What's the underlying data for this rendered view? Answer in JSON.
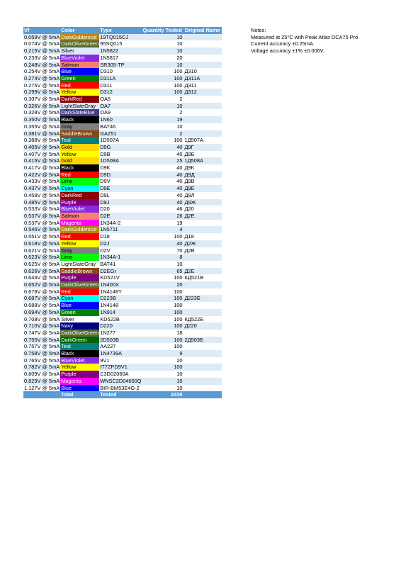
{
  "headers": [
    "Vf",
    "Color",
    "Type",
    "Quantity Tested",
    "Original Name"
  ],
  "rows": [
    {
      "vf": "0.059V @ 5mA",
      "color": "DarkGoldenrod",
      "swatch": "#b8860b",
      "text": "#ffffff",
      "type": "19TQ015CJ",
      "qty": "10",
      "orig": ""
    },
    {
      "vf": "0.074V @ 5mA",
      "color": "DarkOliveGreen",
      "swatch": "#556b2f",
      "text": "#ffffff",
      "type": "95SQ015",
      "qty": "10",
      "orig": ""
    },
    {
      "vf": "0.215V @ 5mA",
      "color": "Silver",
      "swatch": "",
      "text": "",
      "type": "1N5822",
      "qty": "10",
      "orig": ""
    },
    {
      "vf": "0.233V @ 5mA",
      "color": "BlueViolet",
      "swatch": "#8a2be2",
      "text": "#ffffff",
      "type": "1N5817",
      "qty": "20",
      "orig": ""
    },
    {
      "vf": "0.248V @ 5mA",
      "color": "Salmon",
      "swatch": "#fa8072",
      "text": "#000000",
      "type": "SR305-TP",
      "qty": "10",
      "orig": ""
    },
    {
      "vf": "0.254V @ 5mA",
      "color": "Blue",
      "swatch": "#0000ff",
      "text": "#ffffff",
      "type": "D310",
      "qty": "100",
      "orig": "Д310"
    },
    {
      "vf": "0.274V @ 5mA",
      "color": "Green",
      "swatch": "#008000",
      "text": "#ffffff",
      "type": "D311A",
      "qty": "100",
      "orig": "Д311А"
    },
    {
      "vf": "0.275V @ 5mA",
      "color": "Red",
      "swatch": "#ff0000",
      "text": "#ffffff",
      "type": "D311",
      "qty": "100",
      "orig": "Д311"
    },
    {
      "vf": "0.299V @ 5mA",
      "color": "Yellow",
      "swatch": "#ffff00",
      "text": "#000000",
      "type": "D312",
      "qty": "100",
      "orig": "Д312"
    },
    {
      "vf": "0.307V @ 5mA",
      "color": "DarkRed",
      "swatch": "#8b0000",
      "text": "#ffffff",
      "type": "OA5",
      "qty": "2",
      "orig": ""
    },
    {
      "vf": "0.326V @ 5mA",
      "color": "LightSlateGray",
      "swatch": "",
      "text": "",
      "type": "OA7",
      "qty": "10",
      "orig": ""
    },
    {
      "vf": "0.328V @ 5mA",
      "color": "DarkSlateBlue",
      "swatch": "#483d8b",
      "text": "#ffffff",
      "type": "OA9",
      "qty": "2",
      "orig": ""
    },
    {
      "vf": "0.350V @ 5mA",
      "color": "Black",
      "swatch": "#000000",
      "text": "#ffffff",
      "type": "1N60",
      "qty": "19",
      "orig": ""
    },
    {
      "vf": "0.355V @ 5mA",
      "color": "Gray",
      "swatch": "#808080",
      "text": "#000000",
      "type": "BAT46",
      "qty": "10",
      "orig": ""
    },
    {
      "vf": "0.381V @ 5mA",
      "color": "SaddleBrown",
      "swatch": "#8b4513",
      "text": "#ffffff",
      "type": "GAZ51",
      "qty": "2",
      "orig": ""
    },
    {
      "vf": "0.388V @ 5mA",
      "color": "Teal",
      "swatch": "#008080",
      "text": "#ffffff",
      "type": "1D507A",
      "qty": "100",
      "orig": "1Д507А"
    },
    {
      "vf": "0.405V @ 5mA",
      "color": "Gold",
      "swatch": "#ffd700",
      "text": "#000000",
      "type": "D9G",
      "qty": "40",
      "orig": "Д9Г"
    },
    {
      "vf": "0.407V @ 5mA",
      "color": "Yellow",
      "swatch": "#ffff00",
      "text": "#000000",
      "type": "D9B",
      "qty": "40",
      "orig": "Д9Б"
    },
    {
      "vf": "0.415V @ 5mA",
      "color": "Gold",
      "swatch": "#ffd700",
      "text": "#000000",
      "type": "1D508A",
      "qty": "25",
      "orig": "1Д508А"
    },
    {
      "vf": "0.417V @ 5mA",
      "color": "Black",
      "swatch": "#000000",
      "text": "#ffffff",
      "type": "D9K",
      "qty": "40",
      "orig": "Д9К"
    },
    {
      "vf": "0.422V @ 5mA",
      "color": "Red",
      "swatch": "#ff0000",
      "text": "#ffffff",
      "type": "D9D",
      "qty": "40",
      "orig": "Д9Д"
    },
    {
      "vf": "0.433V @ 5mA",
      "color": "Lime",
      "swatch": "#00ff00",
      "text": "#000000",
      "type": "D9V",
      "qty": "40",
      "orig": "Д9В"
    },
    {
      "vf": "0.437V @ 5mA",
      "color": "Cyan",
      "swatch": "#00ffff",
      "text": "#000000",
      "type": "D9E",
      "qty": "40",
      "orig": "Д9Е"
    },
    {
      "vf": "0.459V @ 5mA",
      "color": "DarkRed",
      "swatch": "#8b0000",
      "text": "#ffffff",
      "type": "D9L",
      "qty": "40",
      "orig": "Д9Л"
    },
    {
      "vf": "0.485V @ 5mA",
      "color": "Purple",
      "swatch": "#800080",
      "text": "#ffffff",
      "type": "D9J",
      "qty": "40",
      "orig": "Д9Ж"
    },
    {
      "vf": "0.533V @ 5mA",
      "color": "BlueViolet",
      "swatch": "#8a2be2",
      "text": "#ffffff",
      "type": "D20",
      "qty": "46",
      "orig": "Д20"
    },
    {
      "vf": "0.537V @ 5mA",
      "color": "Salmon",
      "swatch": "#fa8072",
      "text": "#000000",
      "type": "D2E",
      "qty": "26",
      "orig": "Д2Е"
    },
    {
      "vf": "0.537V @ 5mA",
      "color": "Magenta",
      "swatch": "#ff00ff",
      "text": "#ffffff",
      "type": "1N34A-2",
      "qty": "19",
      "orig": ""
    },
    {
      "vf": "0.546V @ 5mA",
      "color": "DarkGoldenrod",
      "swatch": "#b8860b",
      "text": "#ffffff",
      "type": "1N5711",
      "qty": "4",
      "orig": ""
    },
    {
      "vf": "0.551V @ 5mA",
      "color": "Red",
      "swatch": "#ff0000",
      "text": "#ffffff",
      "type": "D18",
      "qty": "100",
      "orig": "Д18"
    },
    {
      "vf": "0.618V @ 5mA",
      "color": "Yellow",
      "swatch": "#ffff00",
      "text": "#000000",
      "type": "D2J",
      "qty": "40",
      "orig": "Д2Ж"
    },
    {
      "vf": "0.621V @ 5mA",
      "color": "Gray",
      "swatch": "#808080",
      "text": "#000000",
      "type": "D2V",
      "qty": "70",
      "orig": "Д2В"
    },
    {
      "vf": "0.623V @ 5mA",
      "color": "Lime",
      "swatch": "#00ff00",
      "text": "#000000",
      "type": "1N34A-1",
      "qty": "8",
      "orig": ""
    },
    {
      "vf": "0.625V @ 5mA",
      "color": "LightSlateGray",
      "swatch": "",
      "text": "",
      "type": "BAT41",
      "qty": "10",
      "orig": ""
    },
    {
      "vf": "0.626V @ 5mA",
      "color": "SaddleBrown",
      "swatch": "#8b4513",
      "text": "#ffffff",
      "type": "D2EGr",
      "qty": "65",
      "orig": "Д2Е"
    },
    {
      "vf": "0.644V @ 5mA",
      "color": "Purple",
      "swatch": "#800080",
      "text": "#ffffff",
      "type": "KD521V",
      "qty": "100",
      "orig": "КД521В"
    },
    {
      "vf": "0.652V @ 5mA",
      "color": "DarkOliveGreen",
      "swatch": "#556b2f",
      "text": "#ffffff",
      "type": "1N400X",
      "qty": "20",
      "orig": ""
    },
    {
      "vf": "0.678V @ 5mA",
      "color": "Red",
      "swatch": "#ff0000",
      "text": "#ffffff",
      "type": "1N4148Y",
      "qty": "100",
      "orig": ""
    },
    {
      "vf": "0.687V @ 5mA",
      "color": "Cyan",
      "swatch": "#00ffff",
      "text": "#000000",
      "type": "D223B",
      "qty": "100",
      "orig": "Д223Б"
    },
    {
      "vf": "0.688V @ 5mA",
      "color": "Blue",
      "swatch": "#0000ff",
      "text": "#ffffff",
      "type": "1N4148",
      "qty": "100",
      "orig": ""
    },
    {
      "vf": "0.694V @ 5mA",
      "color": "Green",
      "swatch": "#008000",
      "text": "#ffffff",
      "type": "1N914",
      "qty": "100",
      "orig": ""
    },
    {
      "vf": "0.708V @ 5mA",
      "color": "Silver",
      "swatch": "",
      "text": "",
      "type": "KD522B",
      "qty": "100",
      "orig": "КД522Б"
    },
    {
      "vf": "0.710V @ 5mA",
      "color": "Navy",
      "swatch": "#000080",
      "text": "#ffffff",
      "type": "D220",
      "qty": "100",
      "orig": "Д220"
    },
    {
      "vf": "0.747V @ 5mA",
      "color": "DarkOliveGreen",
      "swatch": "#556b2f",
      "text": "#ffffff",
      "type": "1N277",
      "qty": "18",
      "orig": ""
    },
    {
      "vf": "0.755V @ 5mA",
      "color": "DarkGreen",
      "swatch": "#006400",
      "text": "#ffffff",
      "type": "2D503B",
      "qty": "100",
      "orig": "2Д503Б"
    },
    {
      "vf": "0.757V @ 5mA",
      "color": "Teal",
      "swatch": "#008080",
      "text": "#ffffff",
      "type": "AA227",
      "qty": "100",
      "orig": ""
    },
    {
      "vf": "0.758V @ 5mA",
      "color": "Black",
      "swatch": "#000000",
      "text": "#ffffff",
      "type": "1N4739A",
      "qty": "9",
      "orig": ""
    },
    {
      "vf": "0.765V @ 5mA",
      "color": "BlueViolet",
      "swatch": "#8a2be2",
      "text": "#ffffff",
      "type": "9V1",
      "qty": "20",
      "orig": ""
    },
    {
      "vf": "0.782V @ 5mA",
      "color": "Yellow",
      "swatch": "#ffff00",
      "text": "#000000",
      "type": "IT7ZPD9V1",
      "qty": "100",
      "orig": ""
    },
    {
      "vf": "0.809V @ 5mA",
      "color": "Purple",
      "swatch": "#800080",
      "text": "#ffffff",
      "type": "C3D02060A",
      "qty": "10",
      "orig": ""
    },
    {
      "vf": "0.829V @ 5mA",
      "color": "Magenta",
      "swatch": "#ff00ff",
      "text": "#ffffff",
      "type": "WNSC2D04650Q",
      "qty": "10",
      "orig": ""
    },
    {
      "vf": "1.127V @ 5mA",
      "color": "Blue",
      "swatch": "#0000ff",
      "text": "#ffffff",
      "type": "BIR-BM53E4G-2",
      "qty": "10",
      "orig": ""
    }
  ],
  "footer": {
    "vf": "",
    "color": "Total",
    "type": "Tested",
    "qty": "2435",
    "orig": ""
  },
  "notes": {
    "title": "Notes:",
    "line1": "Measured at 25°C with Peak Atlas DCA75 Pro",
    "line2": "Current accuracy ±0.25mA.",
    "line3": "Voltage accuracy ±1% ±0.006V."
  },
  "colors": {
    "header_bg": "#5b9bd5",
    "band_bg": "#ddebf7"
  }
}
